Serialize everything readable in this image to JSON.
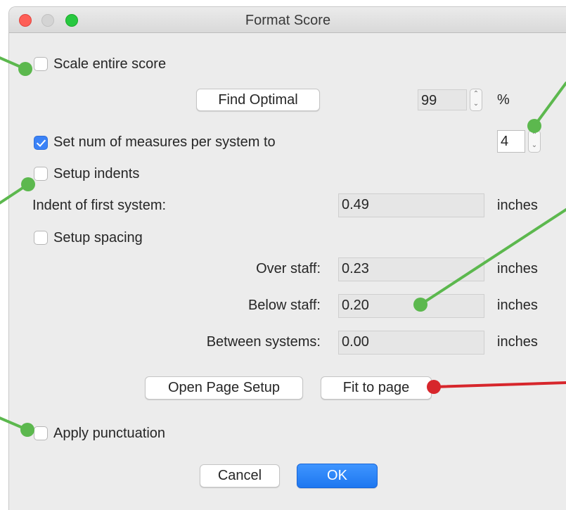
{
  "window": {
    "title": "Format Score"
  },
  "scale": {
    "checkbox_label": "Scale entire score",
    "checked": false,
    "find_optimal_label": "Find Optimal",
    "percent_value": "99",
    "percent_unit": "%"
  },
  "measures": {
    "checkbox_label": "Set num of measures per system to",
    "checked": true,
    "value": "4"
  },
  "indents": {
    "checkbox_label": "Setup indents",
    "checked": false,
    "first_system_label": "Indent of first system:",
    "first_system_value": "0.49",
    "unit": "inches"
  },
  "spacing": {
    "checkbox_label": "Setup spacing",
    "checked": false,
    "over_staff_label": "Over staff:",
    "over_staff_value": "0.23",
    "below_staff_label": "Below staff:",
    "below_staff_value": "0.20",
    "between_systems_label": "Between systems:",
    "between_systems_value": "0.00",
    "unit": "inches"
  },
  "page": {
    "open_page_setup_label": "Open Page Setup",
    "fit_to_page_label": "Fit to page"
  },
  "punctuation": {
    "checkbox_label": "Apply punctuation",
    "checked": false
  },
  "footer": {
    "cancel_label": "Cancel",
    "ok_label": "OK"
  },
  "colors": {
    "callout_green": "#5cb84e",
    "callout_red": "#d7262c",
    "accent_blue": "#3a82f7"
  }
}
